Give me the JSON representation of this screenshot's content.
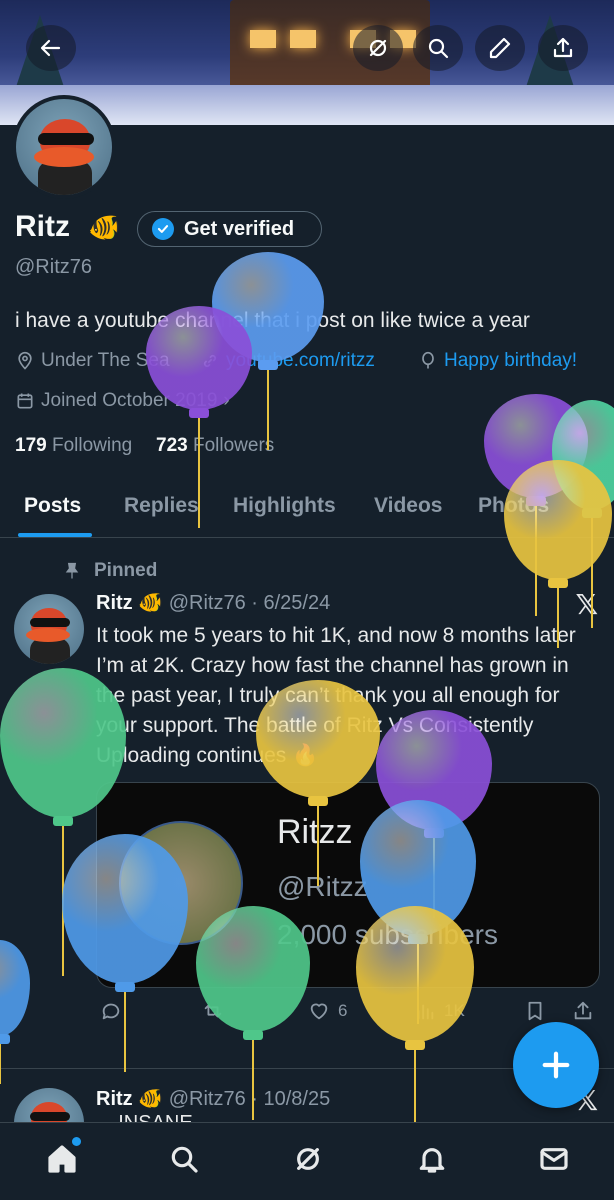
{
  "header": {
    "back_icon": "arrow-left-icon",
    "actions": [
      "grok-icon",
      "search-icon",
      "pen-icon",
      "share-icon"
    ]
  },
  "profile": {
    "name": "Ritz",
    "name_emoji": "🐠",
    "get_verified_label": "Get verified",
    "handle": "@Ritz76",
    "bio": "i have a youtube channel that i post on like twice a year",
    "location": "Under The Sea",
    "website": "youtube.com/ritzz",
    "birthday": "Happy birthday!",
    "joined": "Joined October 2019",
    "following_count": "179",
    "following_label": "Following",
    "followers_count": "723",
    "followers_label": "Followers"
  },
  "tabs": [
    "Posts",
    "Replies",
    "Highlights",
    "Videos",
    "Photos"
  ],
  "pinned_post": {
    "pinned_label": "Pinned",
    "name": "Ritz",
    "name_emoji": "🐠",
    "handle_date": "@Ritz76 · 6/25/24",
    "text": "It took me 5 years to hit 1K, and now 8 months later I’m at 2K. Crazy how fast the channel has grown in the past year, I truly can’t thank you all enough for your support. The battle of Ritz Vs Consistently Uploading continues 🔥",
    "card": {
      "title": "Ritzz",
      "handle": "@Ritzz",
      "subscribers": "2,000 subscribers"
    },
    "likes": "6",
    "views": "1K"
  },
  "second_post": {
    "name": "Ritz",
    "name_emoji": "🐠",
    "handle_date": "@Ritz76 · 10/8/25",
    "text": "... INSANE ..."
  },
  "bottom_nav": [
    "home-icon",
    "search-icon",
    "grok-icon",
    "notifications-icon",
    "messages-icon"
  ],
  "colors": {
    "background": "#15202b",
    "accent": "#1d9bf0",
    "secondary_text": "#8b98a5"
  }
}
